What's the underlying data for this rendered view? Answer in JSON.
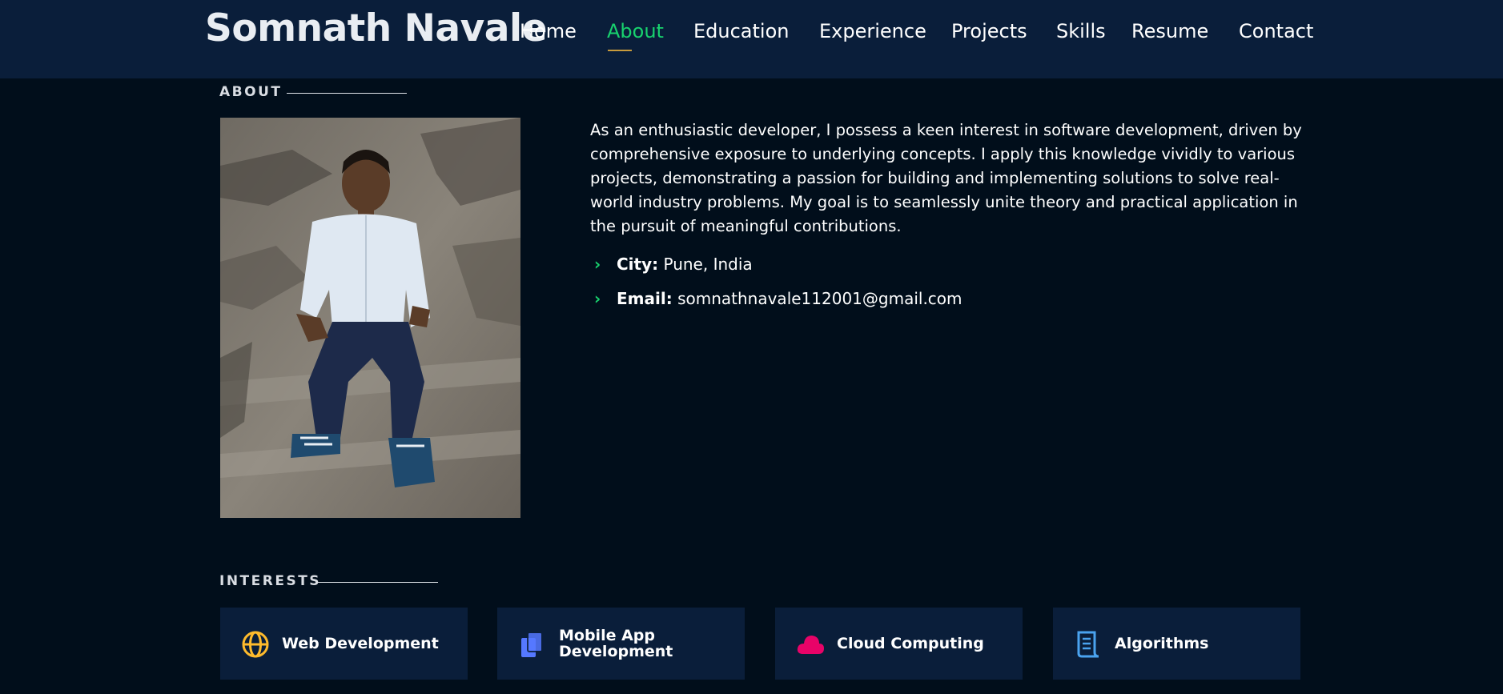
{
  "header": {
    "brand": "Somnath Navale",
    "nav": [
      {
        "label": "Home",
        "active": false
      },
      {
        "label": "About",
        "active": true
      },
      {
        "label": "Education",
        "active": false
      },
      {
        "label": "Experience",
        "active": false
      },
      {
        "label": "Projects",
        "active": false
      },
      {
        "label": "Skills",
        "active": false
      },
      {
        "label": "Resume",
        "active": false
      },
      {
        "label": "Contact",
        "active": false
      }
    ]
  },
  "about": {
    "section_title": "ABOUT",
    "bio": "As an enthusiastic developer, I possess a keen interest in software development, driven by comprehensive exposure to underlying concepts. I apply this knowledge vividly to various projects, demonstrating a passion for building and implementing solutions to solve real-world industry problems. My goal is to seamlessly unite theory and practical application in the pursuit of meaningful contributions.",
    "city_label": "City:",
    "city_value": "Pune, India",
    "email_label": "Email:",
    "email_value": "somnathnavale112001@gmail.com"
  },
  "interests": {
    "section_title": "INTERESTS",
    "items": [
      {
        "line1": "Web Development",
        "line2": "",
        "icon": "globe-icon",
        "color": "#ffbb2c"
      },
      {
        "line1": "Mobile App",
        "line2": "Development",
        "icon": "copy-icon",
        "color": "#5578ff"
      },
      {
        "line1": "Cloud Computing",
        "line2": "",
        "icon": "cloud-icon",
        "color": "#e80368"
      },
      {
        "line1": "Algorithms",
        "line2": "",
        "icon": "document-icon",
        "color": "#4aa3ef"
      }
    ]
  },
  "colors": {
    "background": "#010e1b",
    "header_bg": "#0a1e3a",
    "accent": "#18d26e",
    "underline": "#c89b3c"
  }
}
